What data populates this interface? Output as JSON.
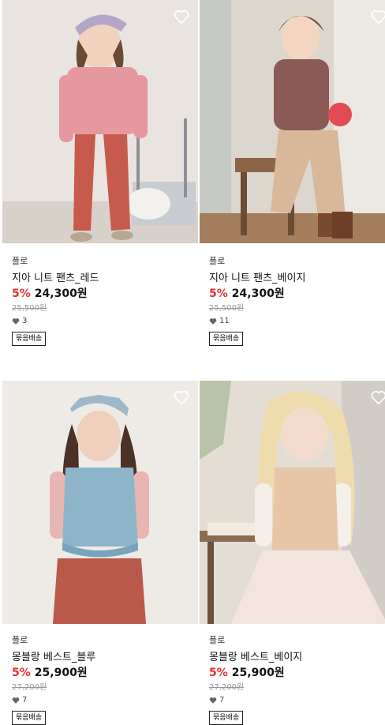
{
  "products": [
    {
      "brand": "플로",
      "name": "지아 니트 팬츠_레드",
      "discount": "5%",
      "price": "24,300원",
      "original_price": "25,500원",
      "likes": "3",
      "badge": "묶음배송"
    },
    {
      "brand": "플로",
      "name": "지아 니트 팬츠_베이지",
      "discount": "5%",
      "price": "24,300원",
      "original_price": "25,500원",
      "likes": "11",
      "badge": "묶음배송"
    },
    {
      "brand": "플로",
      "name": "몽블랑 베스트_블루",
      "discount": "5%",
      "price": "25,900원",
      "original_price": "27,200원",
      "likes": "7",
      "badge": "묶음배송"
    },
    {
      "brand": "플로",
      "name": "몽블랑 베스트_베이지",
      "discount": "5%",
      "price": "25,900원",
      "original_price": "27,200원",
      "likes": "7",
      "badge": "묶음배송"
    }
  ],
  "colors": {
    "discount": "#e0302f",
    "strike": "#999999",
    "heart_outline": "#ffffff",
    "like_heart": "#666666"
  },
  "icons": {
    "wishlist": "heart-outline-icon",
    "likes": "heart-icon"
  }
}
